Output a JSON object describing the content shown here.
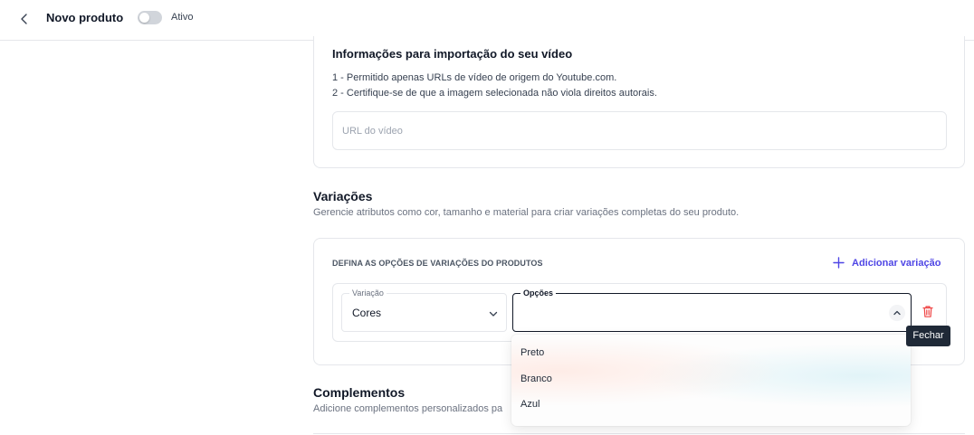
{
  "header": {
    "title": "Novo produto",
    "active_label": "Ativo",
    "active_toggle_on": false
  },
  "video": {
    "title": "Informações para importação do seu vídeo",
    "rules": [
      "1 - Permitido apenas URLs de vídeo de origem do Youtube.com.",
      "2 - Certifique-se de que a imagem selecionada não viola direitos autorais."
    ],
    "url_placeholder": "URL do vídeo",
    "url_value": ""
  },
  "variations": {
    "title": "Variações",
    "description": "Gerencie atributos como cor, tamanho e material para criar variações completas do seu produto.",
    "options_heading": "DEFINA AS OPÇÕES DE VARIAÇÕES DO PRODUTOS",
    "add_label": "Adicionar variação",
    "row": {
      "variation_label": "Variação",
      "variation_value": "Cores",
      "options_label": "Opções",
      "options_value": ""
    },
    "tooltip": "Fechar",
    "dropdown_options": [
      "Preto",
      "Branco",
      "Azul"
    ]
  },
  "complements": {
    "title": "Complementos",
    "description": "Adicione complementos personalizados pa"
  },
  "colors": {
    "accent": "#4f46e5",
    "danger": "#ef4444",
    "tooltip_bg": "#1f2937"
  },
  "icons": {
    "back": "chevron-left-icon",
    "add": "plus-icon",
    "select_chevron": "chevron-down-icon",
    "dropdown_toggle": "chevron-up-icon",
    "delete": "trash-icon"
  }
}
